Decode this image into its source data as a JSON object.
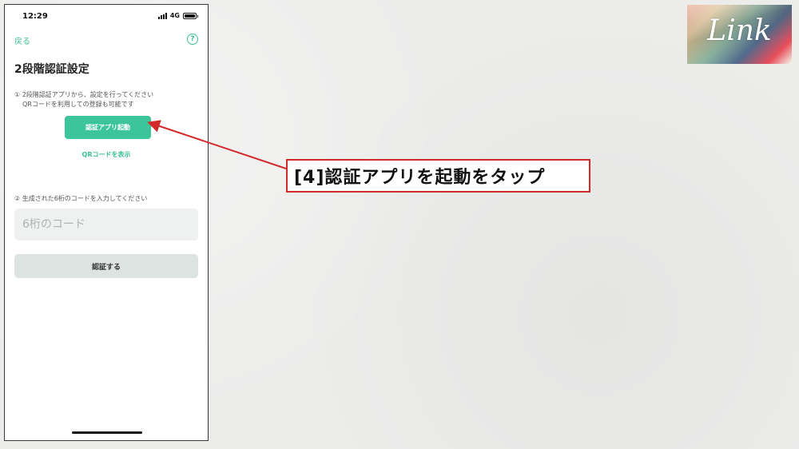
{
  "status_bar": {
    "time": "12:29",
    "network": "4G"
  },
  "header": {
    "back_label": "戻る",
    "help_icon": "?"
  },
  "page": {
    "title": "2段階認証設定",
    "step1_line1": "① 2段階認証アプリから、設定を行ってください",
    "step1_line2": "QRコードを利用しての登録も可能です",
    "launch_app_label": "認証アプリ起動",
    "show_qr_label": "QRコードを表示",
    "step2_text": "② 生成された6桁のコードを入力してください",
    "code_placeholder": "6桁のコード",
    "verify_label": "認証する"
  },
  "annotation": {
    "callout_text": "[4]認証アプリを起動をタップ",
    "color": "#d22a2a"
  },
  "logo": {
    "text": "Link"
  },
  "colors": {
    "accent": "#3cc59a"
  }
}
